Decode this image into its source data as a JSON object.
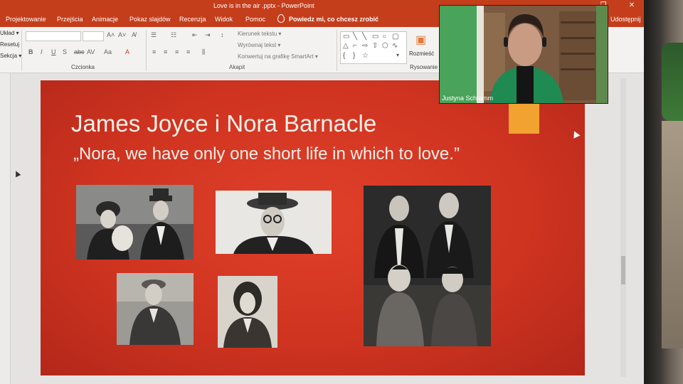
{
  "window": {
    "title": "Love is in the air .pptx  -  PowerPoint"
  },
  "ribbon": {
    "tabs": [
      "Projektowanie",
      "Przejścia",
      "Animacje",
      "Pokaz slajdów",
      "Recenzja",
      "Widok",
      "Pomoc"
    ],
    "tell_me": "Powiedz mi, co chcesz zrobić",
    "share": "Udostępnij",
    "left_cut": [
      "Układ ▾",
      "Resetuj",
      "Sekcja ▾"
    ],
    "groups": {
      "font": "Czcionka",
      "paragraph": "Akapit",
      "drawing": "Rysowanie"
    },
    "paragraph_items": [
      "Kierunek tekstu ▾",
      "Wyrównaj tekst ▾",
      "Konwertuj na grafikę SmartArt ▾"
    ],
    "arrange": "Rozmieść"
  },
  "slide": {
    "title": "James Joyce i Nora Barnacle",
    "quote": "„Nora, we have only one short life in which to love.”"
  },
  "video_call": {
    "participant": "Justyna Schramm"
  },
  "colors": {
    "titlebar": "#c43e1c",
    "slide_bg": "#cf3420",
    "sticky": "#f2a230"
  }
}
